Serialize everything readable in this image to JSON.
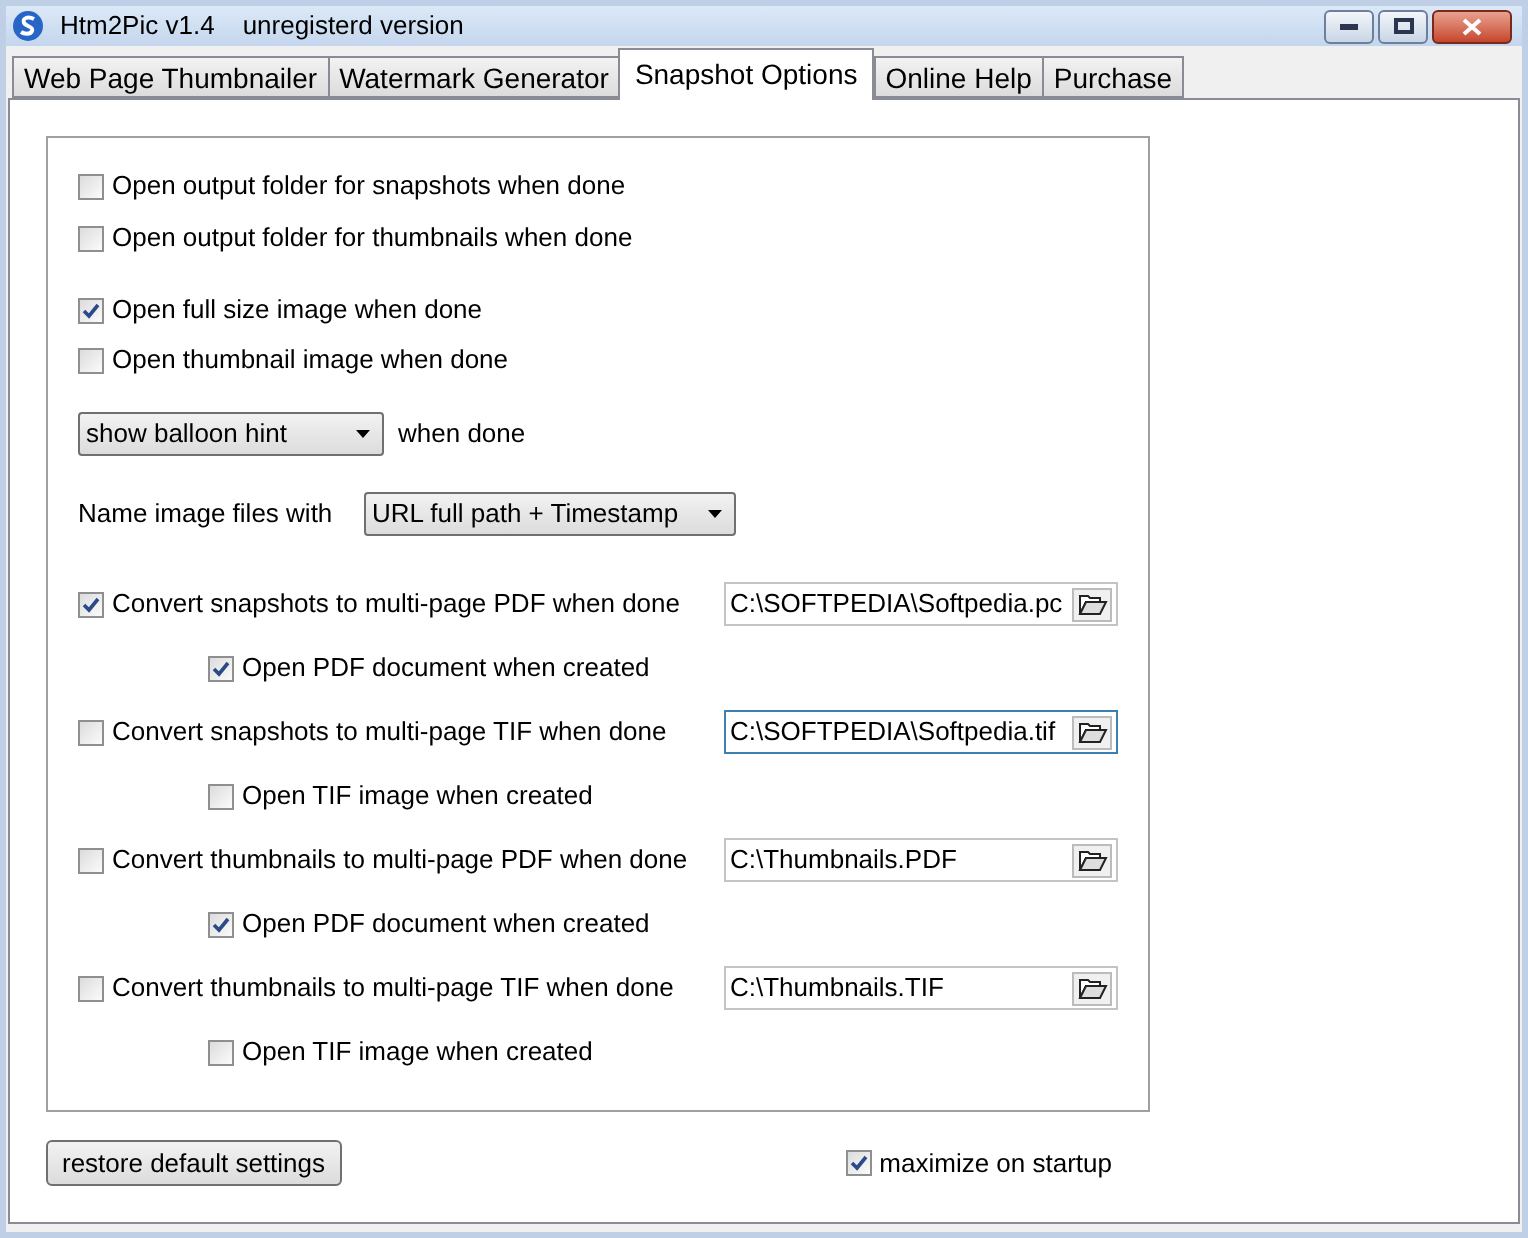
{
  "window": {
    "title": "Htm2Pic v1.4",
    "subtitle": "unregisterd version"
  },
  "tabs": [
    {
      "label": "Web Page Thumbnailer",
      "selected": false
    },
    {
      "label": "Watermark Generator",
      "selected": false
    },
    {
      "label": "Snapshot Options",
      "selected": true
    },
    {
      "label": "Online Help",
      "selected": false
    },
    {
      "label": "Purchase",
      "selected": false
    }
  ],
  "options": [
    {
      "label": "Open output folder for snapshots when done",
      "checked": false
    },
    {
      "label": "Open output folder for thumbnails when done",
      "checked": false
    },
    {
      "label": "Open full size image when done",
      "checked": true
    },
    {
      "label": "Open thumbnail image when done",
      "checked": false
    }
  ],
  "hint": {
    "value": "show balloon hint",
    "suffix": "when done"
  },
  "naming": {
    "label": "Name image files with",
    "value": "URL full path + Timestamp"
  },
  "conversions": [
    {
      "label": "Convert snapshots to multi-page PDF when done",
      "checked": true,
      "path": "C:\\SOFTPEDIA\\Softpedia.pc",
      "focused": false,
      "sub": {
        "label": "Open PDF document when created",
        "checked": true
      }
    },
    {
      "label": "Convert snapshots to multi-page TIF when done",
      "checked": false,
      "path": "C:\\SOFTPEDIA\\Softpedia.tif",
      "focused": true,
      "sub": {
        "label": "Open TIF image when created",
        "checked": false
      }
    },
    {
      "label": "Convert thumbnails to multi-page PDF when done",
      "checked": false,
      "path": "C:\\Thumbnails.PDF",
      "focused": false,
      "sub": {
        "label": "Open PDF document when created",
        "checked": true
      }
    },
    {
      "label": "Convert thumbnails to multi-page TIF when done",
      "checked": false,
      "path": "C:\\Thumbnails.TIF",
      "focused": false,
      "sub": {
        "label": "Open TIF image when created",
        "checked": false
      }
    }
  ],
  "footer": {
    "restore": "restore default settings",
    "maximize": {
      "label": "maximize on startup",
      "checked": true
    }
  }
}
